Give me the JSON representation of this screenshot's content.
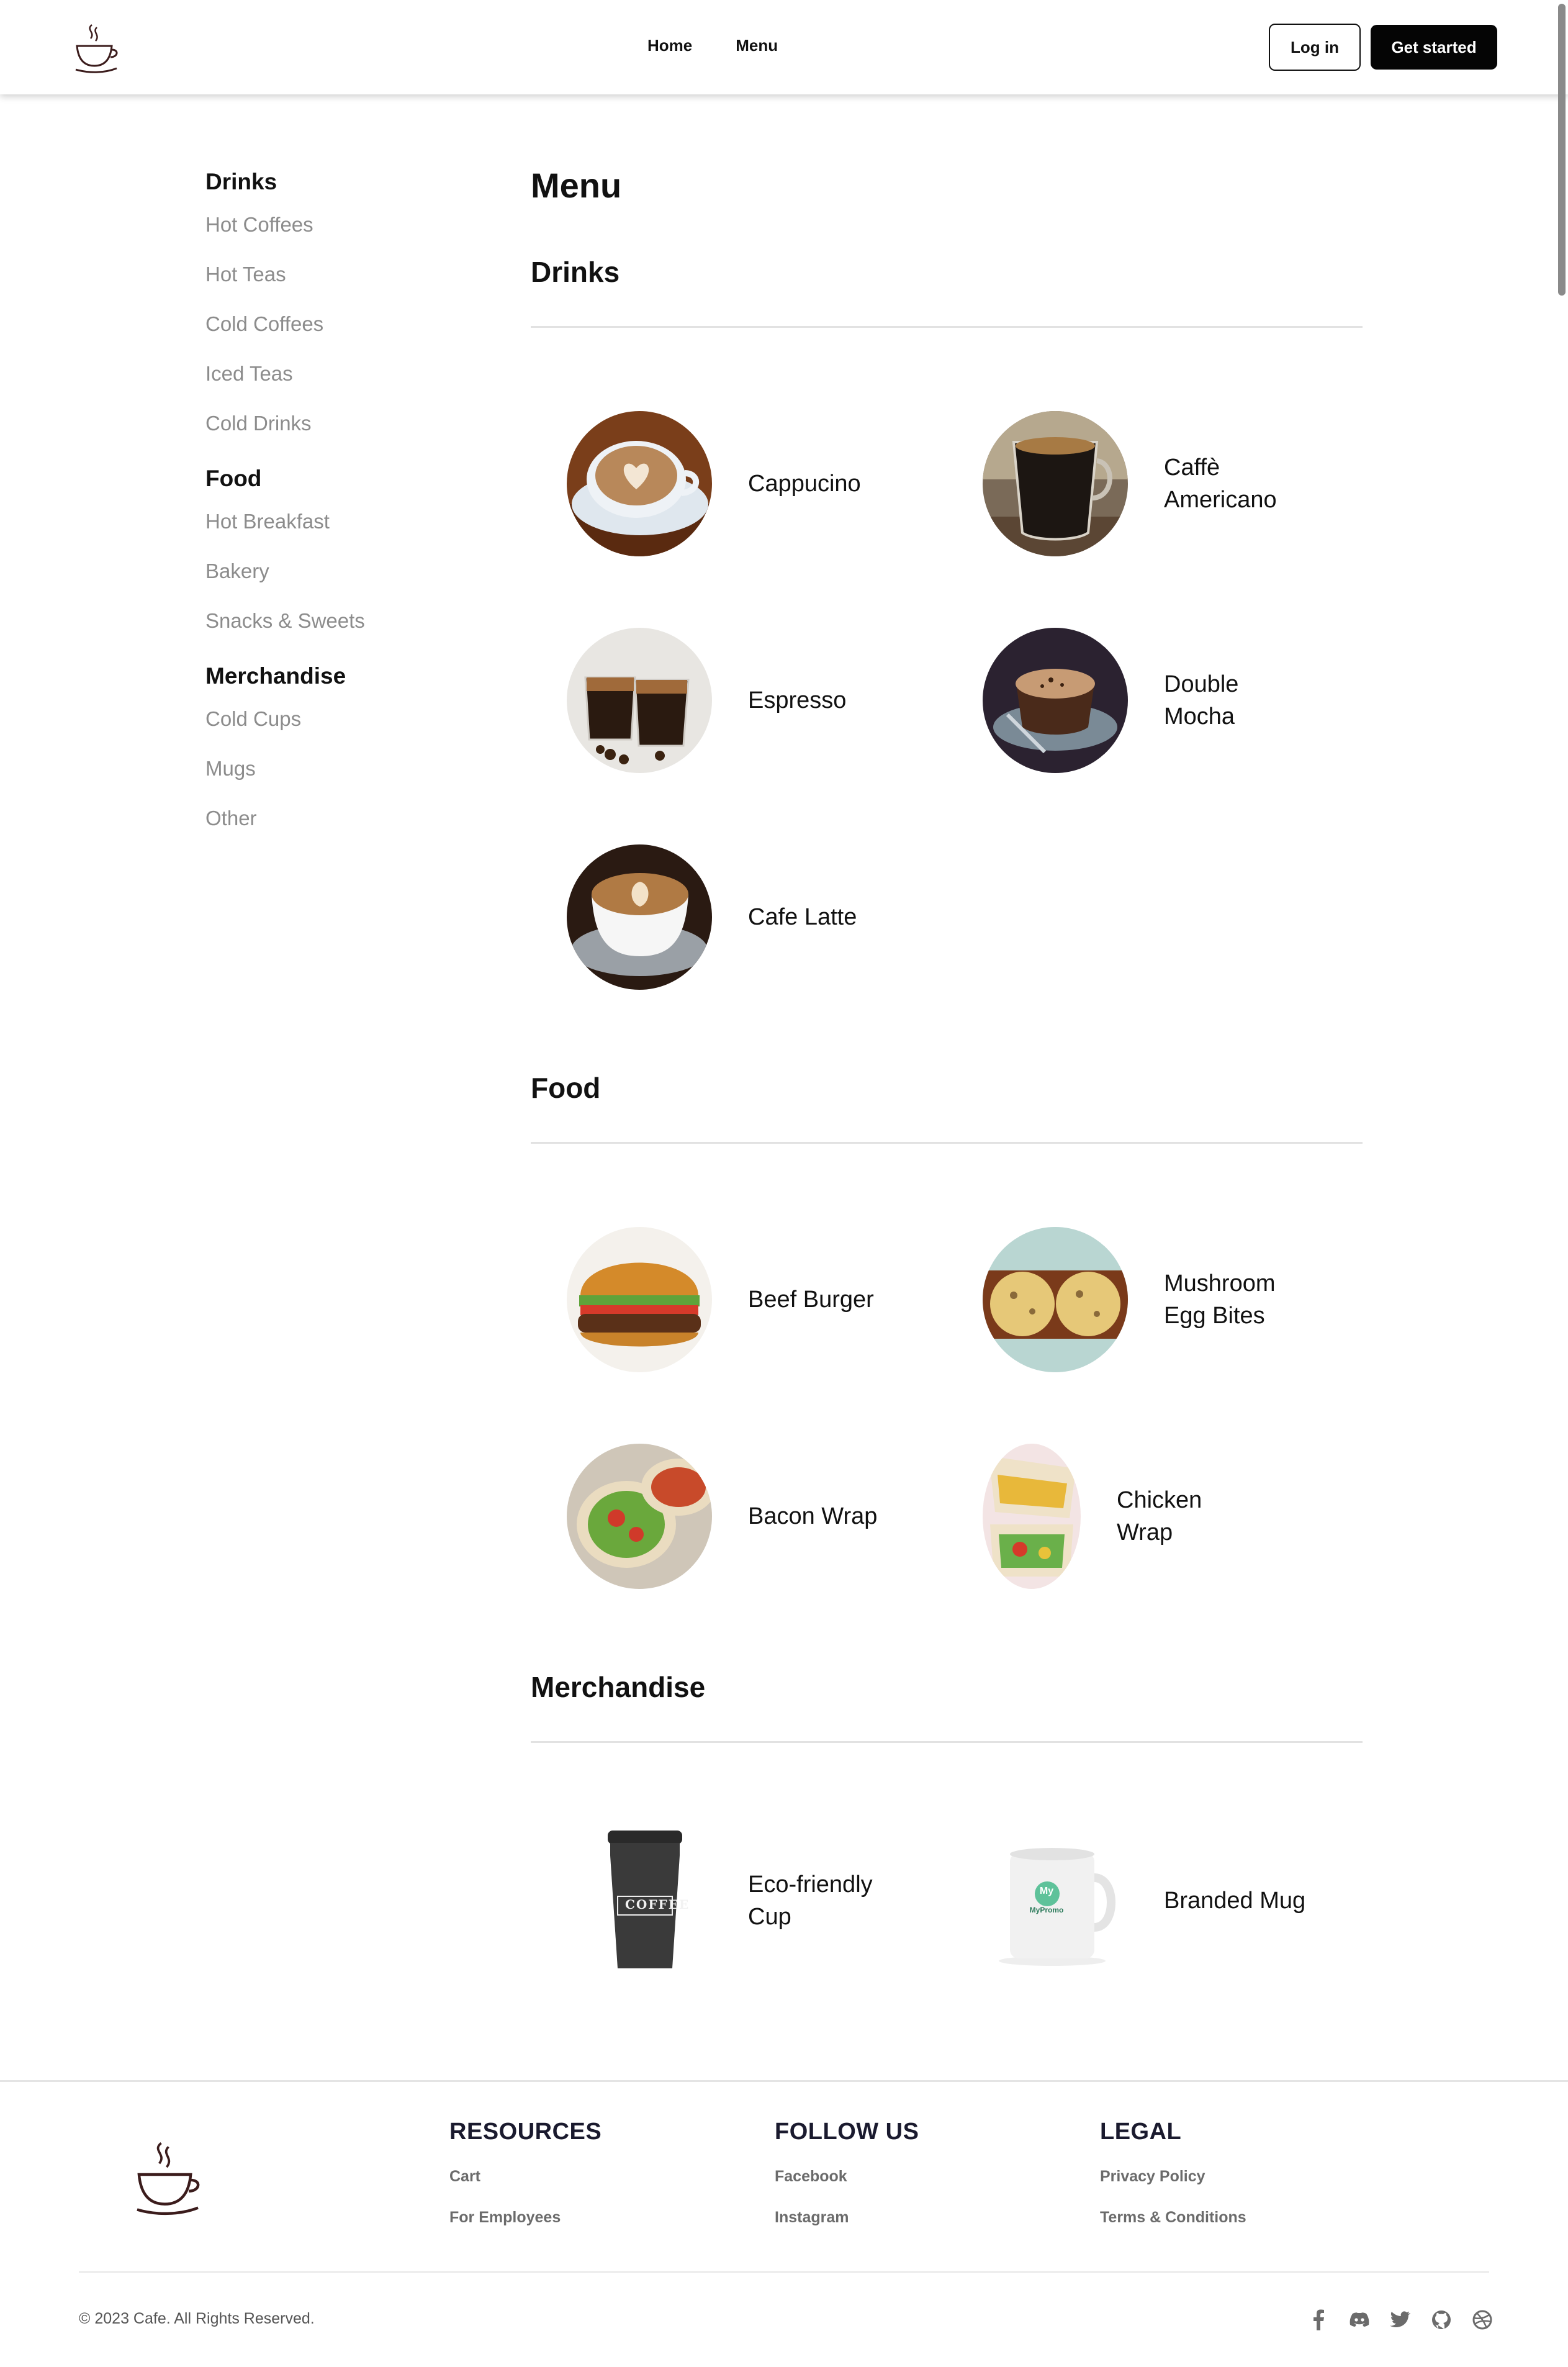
{
  "header": {
    "logo_icon": "coffee-cup-logo-icon",
    "nav": [
      {
        "label": "Home"
      },
      {
        "label": "Menu"
      }
    ],
    "login_label": "Log in",
    "get_started_label": "Get started"
  },
  "sidebar": {
    "groups": [
      {
        "title": "Drinks",
        "links": [
          "Hot Coffees",
          "Hot Teas",
          "Cold Coffees",
          "Iced Teas",
          "Cold Drinks"
        ]
      },
      {
        "title": "Food",
        "links": [
          "Hot Breakfast",
          "Bakery",
          "Snacks & Sweets"
        ]
      },
      {
        "title": "Merchandise",
        "links": [
          "Cold Cups",
          "Mugs",
          "Other"
        ]
      }
    ]
  },
  "main": {
    "title": "Menu",
    "sections": [
      {
        "title": "Drinks",
        "items": [
          {
            "name": "Cappucino",
            "icon": "cappuccino-photo"
          },
          {
            "name": "Caffè Americano",
            "icon": "americano-photo"
          },
          {
            "name": "Espresso",
            "icon": "espresso-photo"
          },
          {
            "name": "Double Mocha",
            "icon": "mocha-photo"
          },
          {
            "name": "Cafe Latte",
            "icon": "latte-photo"
          }
        ]
      },
      {
        "title": "Food",
        "items": [
          {
            "name": "Beef Burger",
            "icon": "burger-photo"
          },
          {
            "name": "Mushroom Egg Bites",
            "icon": "egg-bites-photo"
          },
          {
            "name": "Bacon Wrap",
            "icon": "bacon-wrap-photo"
          },
          {
            "name": "Chicken Wrap",
            "icon": "chicken-wrap-photo"
          }
        ]
      },
      {
        "title": "Merchandise",
        "items": [
          {
            "name": "Eco-friendly Cup",
            "icon": "eco-cup-photo"
          },
          {
            "name": "Branded Mug",
            "icon": "branded-mug-photo"
          }
        ]
      }
    ],
    "eco_cup_text": "COFFEE",
    "mug_logo_text": "My",
    "mug_brand_text": "MyPromo"
  },
  "footer": {
    "columns": [
      {
        "title": "RESOURCES",
        "links": [
          "Cart",
          "For Employees"
        ]
      },
      {
        "title": "FOLLOW US",
        "links": [
          "Facebook",
          "Instagram"
        ]
      },
      {
        "title": "LEGAL",
        "links": [
          "Privacy Policy",
          "Terms & Conditions"
        ]
      }
    ],
    "copyright": "© 2023 Cafe. All Rights Reserved.",
    "social_icons": [
      "facebook-icon",
      "discord-icon",
      "twitter-icon",
      "github-icon",
      "dribbble-icon"
    ]
  },
  "colors": {
    "text": "#111111",
    "muted": "#8c8c8c",
    "button_dark": "#050505",
    "footer_heading": "#1a1a2e"
  }
}
